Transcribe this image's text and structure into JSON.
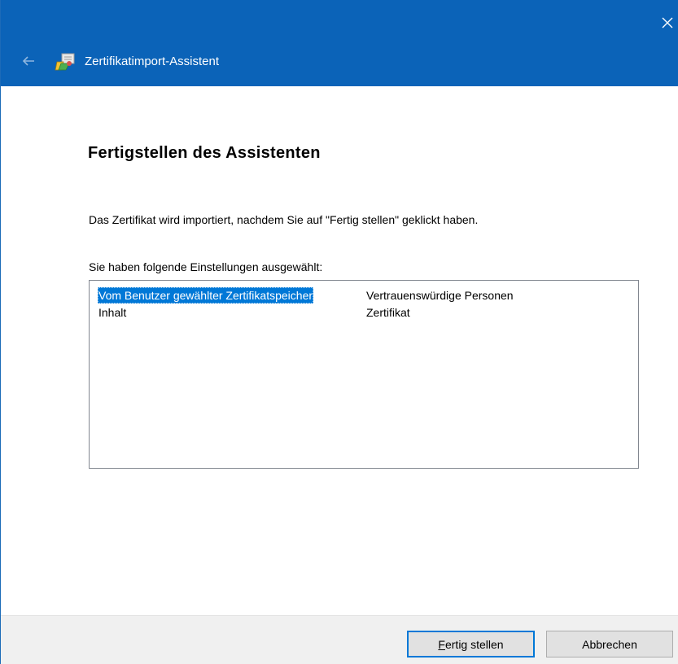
{
  "window": {
    "title": "Zertifikatimport-Assistent",
    "accent_color": "#0b63b8",
    "icons": {
      "close": "close-icon",
      "back": "back-arrow-icon",
      "app": "certificate-icon"
    }
  },
  "page": {
    "heading": "Fertigstellen des Assistenten",
    "description": "Das Zertifikat wird importiert, nachdem Sie auf \"Fertig stellen\" geklickt haben.",
    "settings_label": "Sie haben folgende Einstellungen ausgewählt:"
  },
  "settings": [
    {
      "key": "Vom Benutzer gewählter Zertifikatspeicher",
      "value": "Vertrauenswürdige Personen",
      "selected": true
    },
    {
      "key": "Inhalt",
      "value": "Zertifikat",
      "selected": false
    }
  ],
  "buttons": {
    "finish_mnemonic": "F",
    "finish_rest": "ertig stellen",
    "cancel": "Abbrechen"
  }
}
